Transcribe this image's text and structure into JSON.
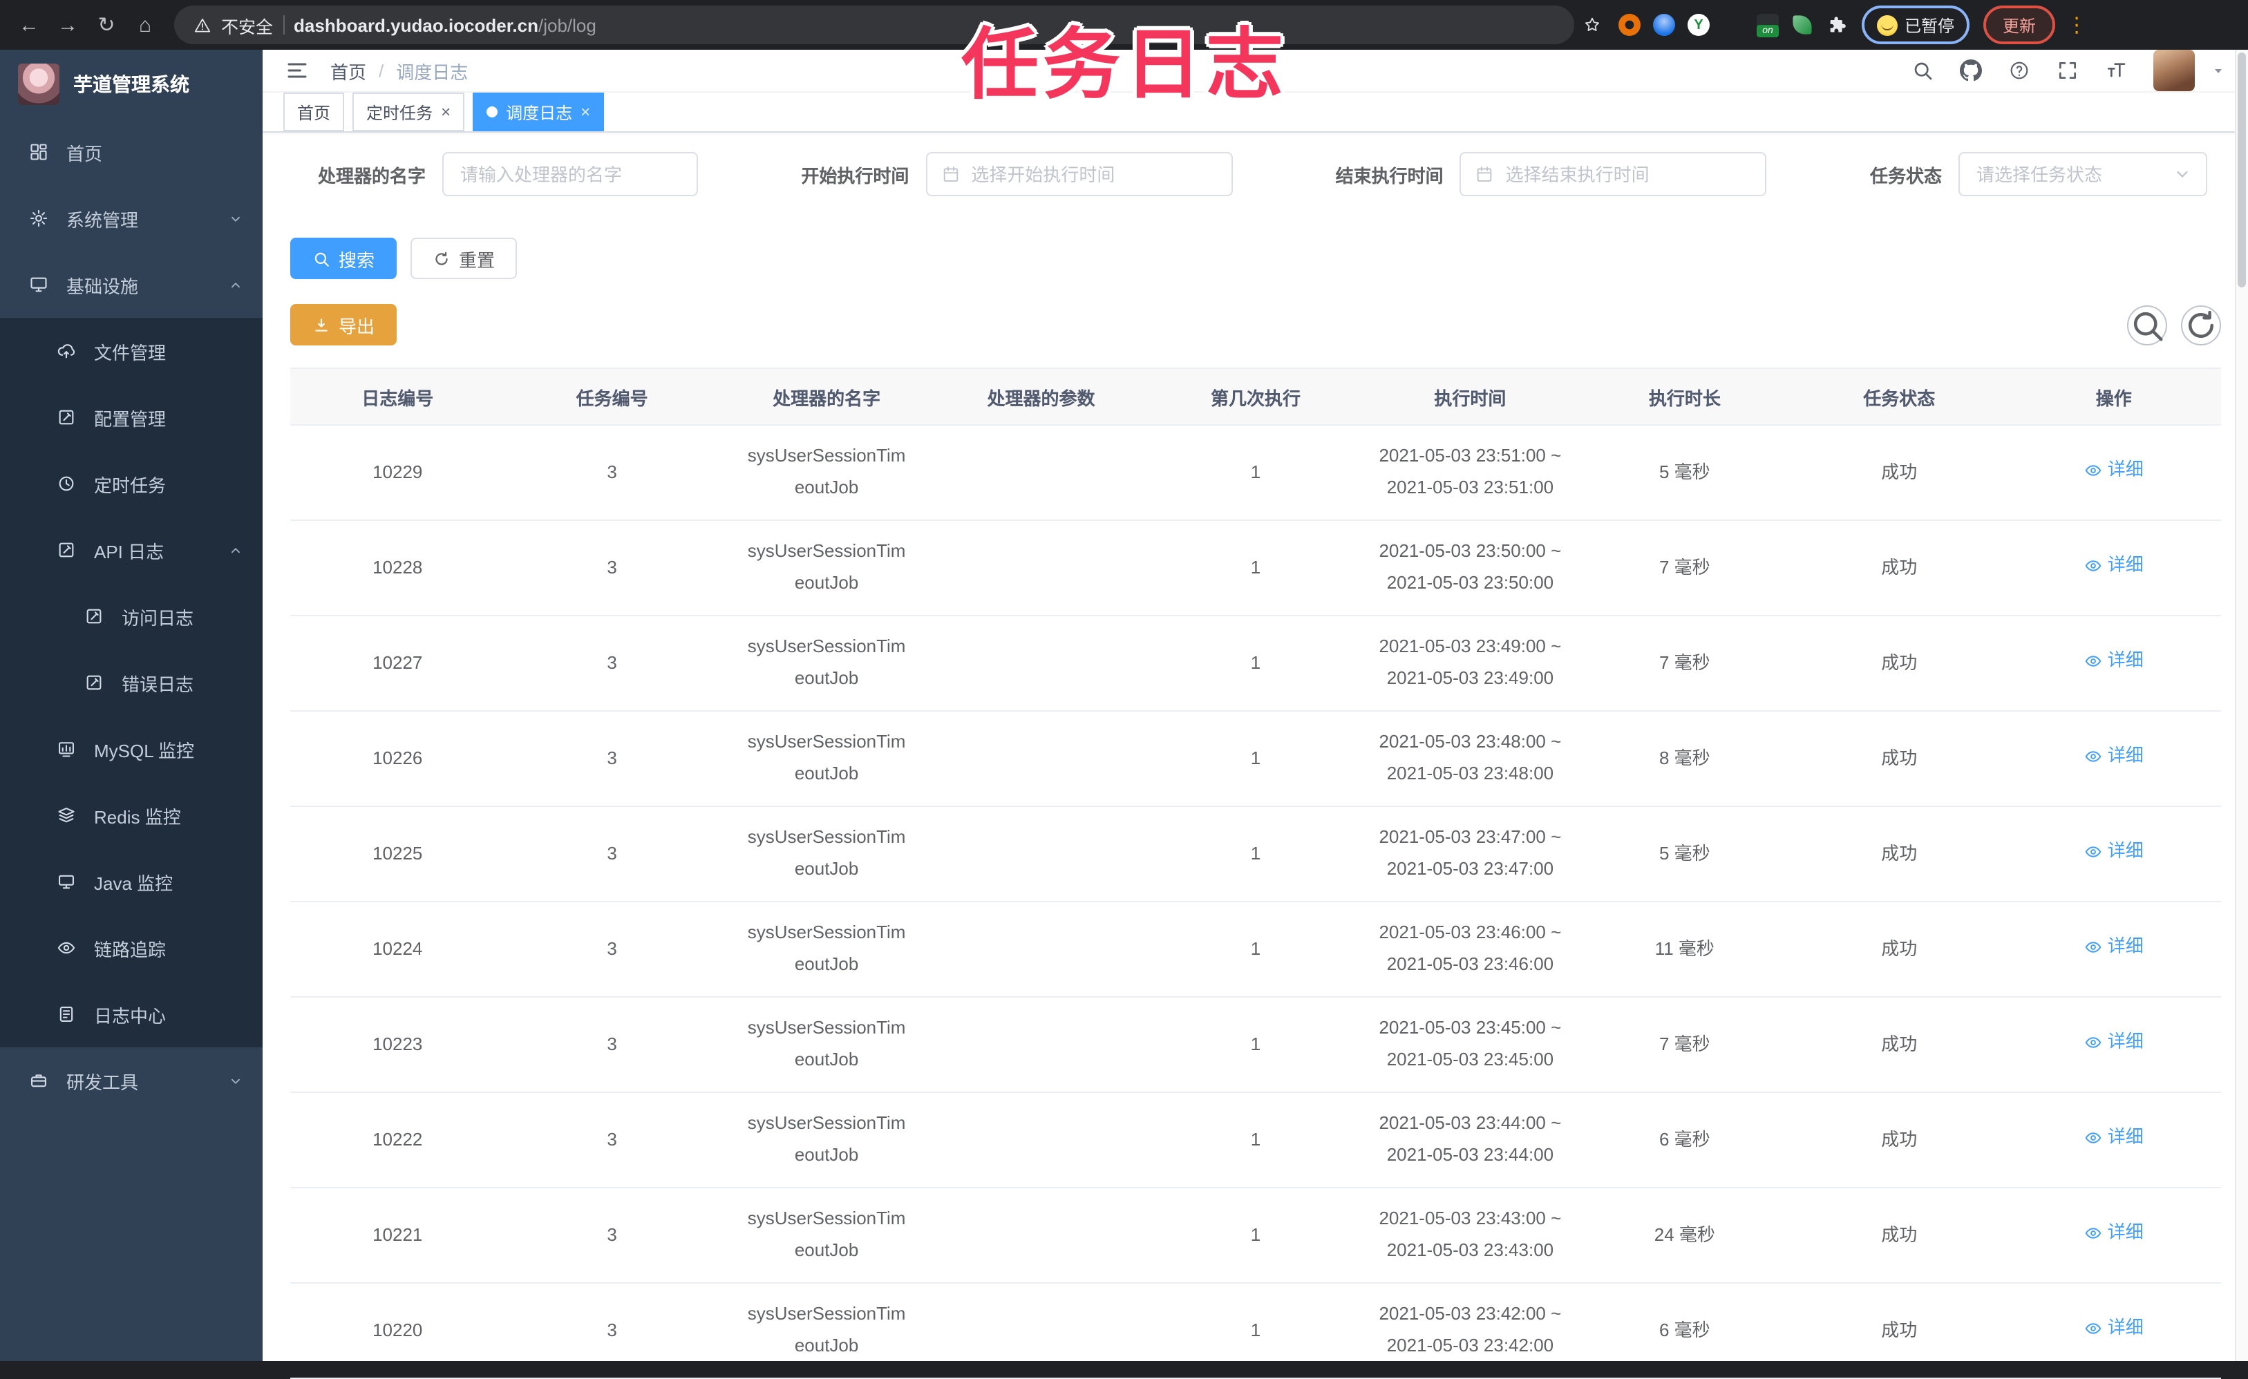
{
  "browser": {
    "security_label": "不安全",
    "url_host": "dashboard.yudao.iocoder.cn",
    "url_path": "/job/log",
    "extension_icons": [
      "ext-orange-icon",
      "ext-blue-icon",
      "ext-y-icon",
      "ext-grid-icon",
      "ext-on-icon",
      "ext-leaf-icon",
      "ext-puzzle-icon"
    ],
    "paused_badge": "已暂停",
    "update_button": "更新"
  },
  "overlay": {
    "title": "任务日志",
    "color": "#f5365c"
  },
  "sidebar": {
    "app_title": "芋道管理系统",
    "items": [
      {
        "label": "首页",
        "icon": "dashboard-icon",
        "level": 1
      },
      {
        "label": "系统管理",
        "icon": "gear-icon",
        "level": 1,
        "chevron": "down"
      },
      {
        "label": "基础设施",
        "icon": "infra-icon",
        "level": 1,
        "chevron": "up"
      },
      {
        "label": "文件管理",
        "icon": "file-icon",
        "level": 2
      },
      {
        "label": "配置管理",
        "icon": "config-icon",
        "level": 2
      },
      {
        "label": "定时任务",
        "icon": "timer-icon",
        "level": 2
      },
      {
        "label": "API 日志",
        "icon": "api-log-icon",
        "level": 2,
        "chevron": "up"
      },
      {
        "label": "访问日志",
        "icon": "access-log-icon",
        "level": 3
      },
      {
        "label": "错误日志",
        "icon": "error-log-icon",
        "level": 3
      },
      {
        "label": "MySQL 监控",
        "icon": "mysql-icon",
        "level": 2
      },
      {
        "label": "Redis 监控",
        "icon": "redis-icon",
        "level": 2
      },
      {
        "label": "Java 监控",
        "icon": "java-icon",
        "level": 2
      },
      {
        "label": "链路追踪",
        "icon": "trace-icon",
        "level": 2
      },
      {
        "label": "日志中心",
        "icon": "logcenter-icon",
        "level": 2
      },
      {
        "label": "研发工具",
        "icon": "devtools-icon",
        "level": 1,
        "chevron": "down"
      }
    ]
  },
  "topbar": {
    "breadcrumb": [
      "首页",
      "调度日志"
    ],
    "separator": "/",
    "icons": [
      "search-icon",
      "github-icon",
      "question-icon",
      "fullscreen-icon",
      "font-size-icon"
    ]
  },
  "tabs": [
    {
      "label": "首页",
      "closable": false,
      "active": false
    },
    {
      "label": "定时任务",
      "closable": true,
      "active": false
    },
    {
      "label": "调度日志",
      "closable": true,
      "active": true
    }
  ],
  "filters": {
    "handler_name": {
      "label": "处理器的名字",
      "placeholder": "请输入处理器的名字"
    },
    "begin_time": {
      "label": "开始执行时间",
      "placeholder": "选择开始执行时间"
    },
    "end_time": {
      "label": "结束执行时间",
      "placeholder": "选择结束执行时间"
    },
    "status": {
      "label": "任务状态",
      "placeholder": "请选择任务状态"
    }
  },
  "buttons": {
    "search": "搜索",
    "reset": "重置",
    "export": "导出"
  },
  "table": {
    "columns": [
      "日志编号",
      "任务编号",
      "处理器的名字",
      "处理器的参数",
      "第几次执行",
      "执行时间",
      "执行时长",
      "任务状态",
      "操作"
    ],
    "detail_label": "详细",
    "rows": [
      {
        "log_id": "10229",
        "task_id": "3",
        "handler": "sysUserSessionTimeoutJob",
        "param": "",
        "exec_index": "1",
        "time_start": "2021-05-03 23:51:00",
        "time_end": "2021-05-03 23:51:00",
        "duration": "5 毫秒",
        "status": "成功"
      },
      {
        "log_id": "10228",
        "task_id": "3",
        "handler": "sysUserSessionTimeoutJob",
        "param": "",
        "exec_index": "1",
        "time_start": "2021-05-03 23:50:00",
        "time_end": "2021-05-03 23:50:00",
        "duration": "7 毫秒",
        "status": "成功"
      },
      {
        "log_id": "10227",
        "task_id": "3",
        "handler": "sysUserSessionTimeoutJob",
        "param": "",
        "exec_index": "1",
        "time_start": "2021-05-03 23:49:00",
        "time_end": "2021-05-03 23:49:00",
        "duration": "7 毫秒",
        "status": "成功"
      },
      {
        "log_id": "10226",
        "task_id": "3",
        "handler": "sysUserSessionTimeoutJob",
        "param": "",
        "exec_index": "1",
        "time_start": "2021-05-03 23:48:00",
        "time_end": "2021-05-03 23:48:00",
        "duration": "8 毫秒",
        "status": "成功"
      },
      {
        "log_id": "10225",
        "task_id": "3",
        "handler": "sysUserSessionTimeoutJob",
        "param": "",
        "exec_index": "1",
        "time_start": "2021-05-03 23:47:00",
        "time_end": "2021-05-03 23:47:00",
        "duration": "5 毫秒",
        "status": "成功"
      },
      {
        "log_id": "10224",
        "task_id": "3",
        "handler": "sysUserSessionTimeoutJob",
        "param": "",
        "exec_index": "1",
        "time_start": "2021-05-03 23:46:00",
        "time_end": "2021-05-03 23:46:00",
        "duration": "11 毫秒",
        "status": "成功"
      },
      {
        "log_id": "10223",
        "task_id": "3",
        "handler": "sysUserSessionTimeoutJob",
        "param": "",
        "exec_index": "1",
        "time_start": "2021-05-03 23:45:00",
        "time_end": "2021-05-03 23:45:00",
        "duration": "7 毫秒",
        "status": "成功"
      },
      {
        "log_id": "10222",
        "task_id": "3",
        "handler": "sysUserSessionTimeoutJob",
        "param": "",
        "exec_index": "1",
        "time_start": "2021-05-03 23:44:00",
        "time_end": "2021-05-03 23:44:00",
        "duration": "6 毫秒",
        "status": "成功"
      },
      {
        "log_id": "10221",
        "task_id": "3",
        "handler": "sysUserSessionTimeoutJob",
        "param": "",
        "exec_index": "1",
        "time_start": "2021-05-03 23:43:00",
        "time_end": "2021-05-03 23:43:00",
        "duration": "24 毫秒",
        "status": "成功"
      },
      {
        "log_id": "10220",
        "task_id": "3",
        "handler": "sysUserSessionTimeoutJob",
        "param": "",
        "exec_index": "1",
        "time_start": "2021-05-03 23:42:00",
        "time_end": "2021-05-03 23:42:00",
        "duration": "6 毫秒",
        "status": "成功"
      }
    ]
  },
  "colors": {
    "accent": "#409eff",
    "warning": "#e6a23c",
    "sidebar_bg": "#304156",
    "submenu_bg": "#1f2d3d",
    "overlay_pink": "#f5365c"
  }
}
